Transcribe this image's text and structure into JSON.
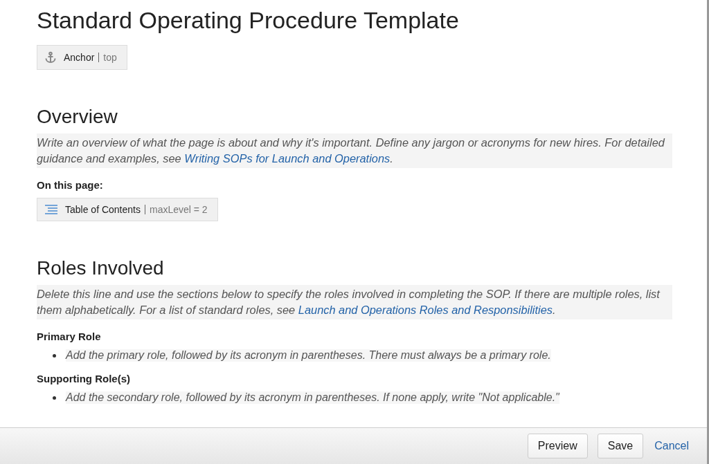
{
  "title": "Standard Operating Procedure Template",
  "anchor_macro": {
    "name": "Anchor",
    "param": "top"
  },
  "sections": [
    {
      "heading": "Overview",
      "instruction": {
        "before": "Write an overview of what the page is about and why it's important. Define any jargon or acronyms for new hires. For detailed guidance and examples, see ",
        "link": "Writing SOPs for Launch and Operations",
        "after": "."
      },
      "blocks": [
        {
          "kind": "label",
          "text": "On this page:"
        },
        {
          "kind": "toc",
          "name": "Table of Contents",
          "param": "maxLevel = 2"
        }
      ]
    },
    {
      "heading": "Roles Involved",
      "instruction": {
        "before": "Delete this line and use the sections below to specify the roles involved in completing the SOP. If there are multiple roles, list them alphabetically. For a list of standard roles, see ",
        "link": "Launch and Operations Roles and Responsibilities",
        "after": "."
      },
      "blocks": [
        {
          "kind": "label",
          "text": "Primary Role"
        },
        {
          "kind": "bullet",
          "text": "Add the primary role, followed by its acronym in parentheses. There must always be a primary role."
        },
        {
          "kind": "label",
          "text": "Supporting Role(s)"
        },
        {
          "kind": "bullet",
          "text": "Add the secondary role, followed by its acronym in parentheses. If none apply, write \"Not applicable.\""
        }
      ]
    }
  ],
  "buttons": [
    "Preview",
    "Save"
  ],
  "cancel": "Cancel"
}
